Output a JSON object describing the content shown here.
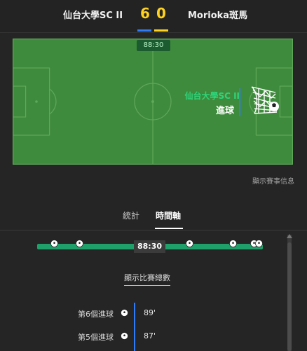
{
  "header": {
    "home_team": "仙台大學SC II",
    "away_team": "Morioka斑馬",
    "home_score": "6",
    "away_score": "0"
  },
  "pitch": {
    "clock": "88:30",
    "event_team": "仙台大學SC II",
    "event_text": "進球"
  },
  "match_info_link": "顯示賽事信息",
  "tabs": {
    "stats": "統計",
    "timeline": "時間軸"
  },
  "timeline": {
    "clock": "88:30",
    "total_link": "顯示比賽總數",
    "events": [
      {
        "label": "第6個進球",
        "minute": "89'"
      },
      {
        "label": "第5個進球",
        "minute": "87'"
      }
    ]
  },
  "colors": {
    "background": "#252525",
    "pitch": "#3f8b3d",
    "score": "#ffd21f",
    "home_accent": "#2f7cf6",
    "track": "#1fa06a",
    "event_team": "#2ed47a"
  },
  "icons": [
    "soccer-ball-icon",
    "goal-net-icon"
  ]
}
